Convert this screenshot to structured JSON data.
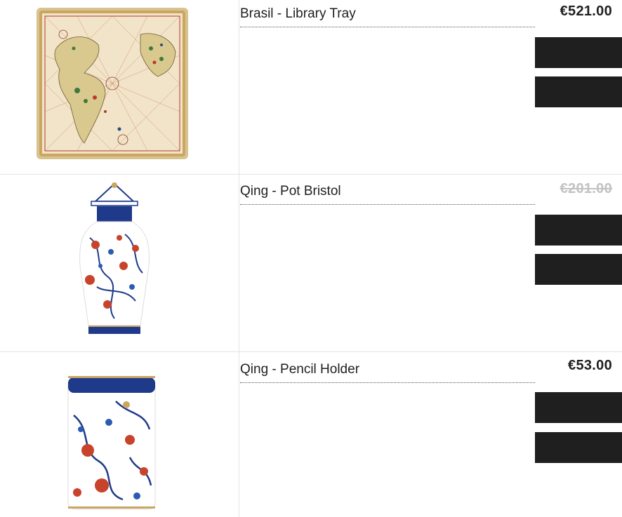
{
  "products": [
    {
      "name": "Brasil - Library Tray",
      "price": "€521.00",
      "price_struck": false,
      "image": "brasil-library-tray-image",
      "button1_label": "",
      "button2_label": ""
    },
    {
      "name": "Qing - Pot Bristol",
      "price": "€201.00",
      "price_struck": true,
      "image": "qing-pot-bristol-image",
      "button1_label": "",
      "button2_label": ""
    },
    {
      "name": "Qing - Pencil Holder",
      "price": "€53.00",
      "price_struck": false,
      "image": "qing-pencil-holder-image",
      "button1_label": "",
      "button2_label": ""
    }
  ],
  "colors": {
    "button": "#1f1f1f",
    "text": "#1f1f1f",
    "struck_price": "#c2c2c2",
    "divider": "#e3e3e3",
    "porcelain_blue": "#1f3a8a",
    "porcelain_red": "#c8432b",
    "map_parchment": "#efe2c6"
  }
}
